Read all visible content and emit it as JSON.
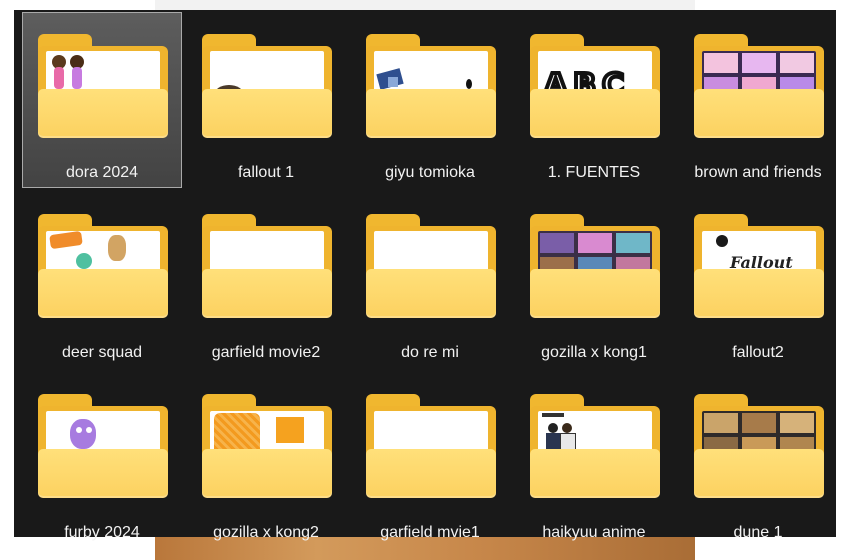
{
  "folders": [
    {
      "name": "dora 2024"
    },
    {
      "name": "fallout 1"
    },
    {
      "name": "giyu tomioka"
    },
    {
      "name": "1. FUENTES"
    },
    {
      "name": "brown and friends"
    },
    {
      "name": "deer squad"
    },
    {
      "name": "garfield movie2"
    },
    {
      "name": "do re mi"
    },
    {
      "name": "gozilla x kong1"
    },
    {
      "name": "fallout2"
    },
    {
      "name": "furby 2024"
    },
    {
      "name": "gozilla x kong2"
    },
    {
      "name": "garfield mvie1"
    },
    {
      "name": "haikyuu anime"
    },
    {
      "name": "dune 1"
    }
  ],
  "selected_folder": "dora 2024",
  "thumbnails": {
    "fuentes_text": "ABC",
    "fallout2_text": "Fallout"
  },
  "colors": {
    "panel_background": "#191919",
    "folder_back": "#efb42e",
    "folder_front": "#fcd160",
    "label_text": "#f2f2f2",
    "selection_border": "#a9a9a9"
  }
}
